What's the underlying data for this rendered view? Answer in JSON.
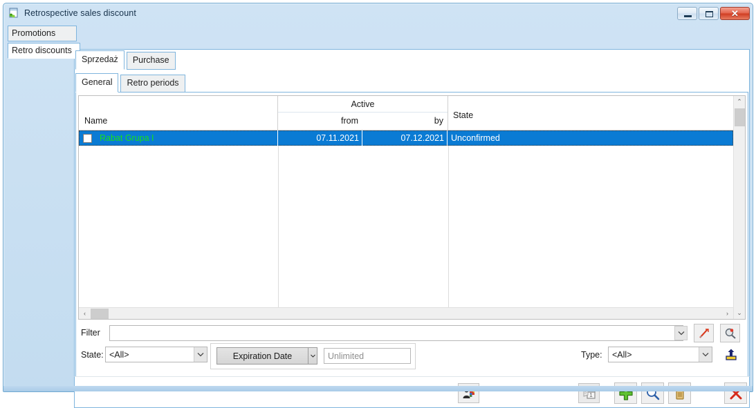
{
  "window": {
    "title": "Retrospective sales discount",
    "icon": "app-window-icon",
    "controls": {
      "minimize": "minimize-button",
      "maximize": "maximize-button",
      "close_glyph": "✕"
    }
  },
  "left_tabs": [
    {
      "label": "Promotions",
      "active": false
    },
    {
      "label": "Retro discounts",
      "active": true
    }
  ],
  "top_tabs": [
    {
      "label": "Sprzedaż",
      "active": true
    },
    {
      "label": "Purchase",
      "active": false
    }
  ],
  "sub_tabs": [
    {
      "label": "General",
      "active": true
    },
    {
      "label": "Retro periods",
      "active": false
    }
  ],
  "grid": {
    "headers": {
      "name": "Name",
      "active_group": "Active",
      "from": "from",
      "by": "by",
      "state": "State"
    },
    "rows": [
      {
        "checked": false,
        "name": "Rabat Grupa I",
        "from": "07.11.2021",
        "by": "07.12.2021",
        "state": "Unconfirmed",
        "selected": true
      }
    ]
  },
  "filters": {
    "filter_label": "Filter",
    "filter_value": "",
    "filter_placeholder": "",
    "state_label": "State:",
    "state_value": "<All>",
    "expiration_button": "Expiration Date",
    "expiration_value": "",
    "expiration_placeholder": "Unlimited",
    "type_label": "Type:",
    "type_value": "<All>"
  },
  "filter_icons": [
    {
      "name": "clear-filter-icon"
    },
    {
      "name": "advanced-filter-icon"
    },
    {
      "name": "export-icon"
    }
  ],
  "commands": [
    {
      "name": "contacts-button",
      "icon": "contacts-icon",
      "disabled": false
    },
    {
      "name": "calendar-button",
      "icon": "calendar-icon",
      "disabled": true
    },
    {
      "name": "add-button",
      "icon": "plus-icon",
      "disabled": false
    },
    {
      "name": "preview-button",
      "icon": "magnifier-icon",
      "disabled": false
    },
    {
      "name": "delete-button",
      "icon": "trash-icon",
      "disabled": false
    },
    {
      "name": "close-button",
      "icon": "red-x-icon",
      "disabled": false
    }
  ],
  "colors": {
    "selection_bg": "#0a7bd4",
    "selection_text": "#19e019",
    "frame": "#7eb4dd",
    "accent_red": "#cc2200",
    "accent_green": "#3faa1e"
  },
  "scroll": {
    "h_left_arrow": "‹",
    "h_right_arrow": "›",
    "v_up_arrow": "⌃",
    "v_down_arrow": "⌄"
  }
}
